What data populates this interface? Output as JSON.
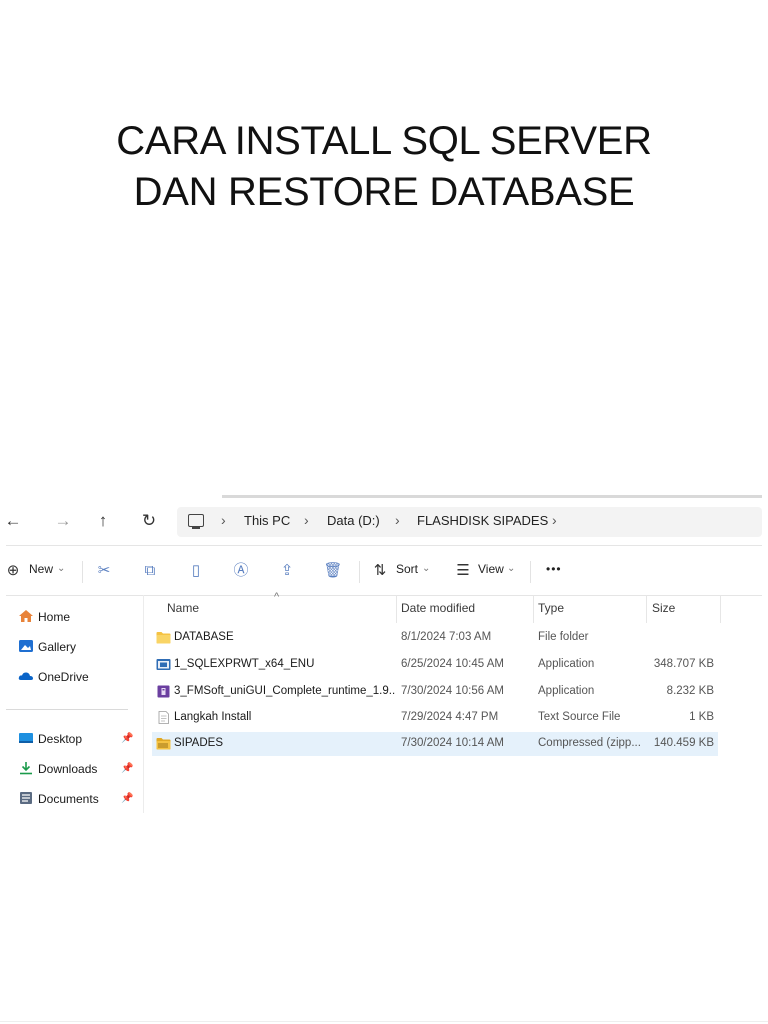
{
  "slide": {
    "title_line1": "CARA INSTALL SQL SERVER",
    "title_line2": "DAN RESTORE DATABASE"
  },
  "explorer": {
    "nav": {
      "back": "←",
      "forward": "→",
      "up": "↑",
      "refresh": "↻"
    },
    "breadcrumb": [
      "This PC",
      "Data (D:)",
      "FLASHDISK SIPADES"
    ],
    "breadcrumb_sep": "›",
    "commands": {
      "new_label": "New",
      "sort_label": "Sort",
      "view_label": "View",
      "more_label": "•••",
      "dropdown_caret": "⌄"
    },
    "sidebar": {
      "items": [
        {
          "label": "Home",
          "icon": "home-icon",
          "color": "#e8833a"
        },
        {
          "label": "Gallery",
          "icon": "gallery-icon",
          "color": "#1f6fd1"
        },
        {
          "label": "OneDrive",
          "icon": "cloud-icon",
          "color": "#0a64c8"
        }
      ],
      "pinned": [
        {
          "label": "Desktop",
          "icon": "desktop-icon",
          "color": "#1e90e0"
        },
        {
          "label": "Downloads",
          "icon": "download-icon",
          "color": "#1b9b4b"
        },
        {
          "label": "Documents",
          "icon": "documents-icon",
          "color": "#5b6b82"
        }
      ]
    },
    "columns": [
      "Name",
      "Date modified",
      "Type",
      "Size"
    ],
    "files": [
      {
        "name": "DATABASE",
        "date": "8/1/2024 7:03 AM",
        "type": "File folder",
        "size": "",
        "icon": "folder-icon"
      },
      {
        "name": "1_SQLEXPRWT_x64_ENU",
        "date": "6/25/2024 10:45 AM",
        "type": "Application",
        "size": "348.707 KB",
        "icon": "app-icon"
      },
      {
        "name": "3_FMSoft_uniGUI_Complete_runtime_1.9...",
        "date": "7/30/2024 10:56 AM",
        "type": "Application",
        "size": "8.232 KB",
        "icon": "installer-icon"
      },
      {
        "name": "Langkah Install",
        "date": "7/29/2024 4:47 PM",
        "type": "Text Source File",
        "size": "1 KB",
        "icon": "text-file-icon"
      },
      {
        "name": "SIPADES",
        "date": "7/30/2024 10:14 AM",
        "type": "Compressed (zipp...",
        "size": "140.459 KB",
        "icon": "zip-folder-icon"
      }
    ],
    "selected_row": 4,
    "colors": {
      "accent": "#0078d4",
      "selection": "#e5f1fb",
      "folder": "#f5c242"
    }
  }
}
